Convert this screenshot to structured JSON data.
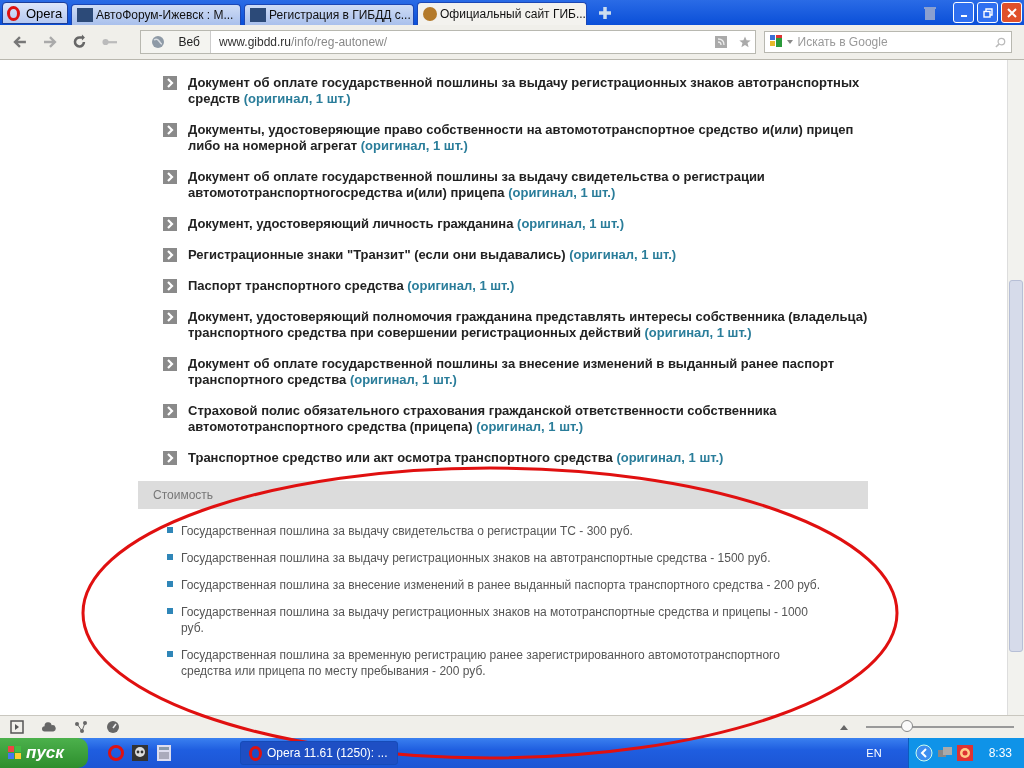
{
  "taskbar_top": {
    "menu_button": "Opera",
    "tabs": [
      {
        "title": "АвтоФорум-Ижевск : М...",
        "selected": false
      },
      {
        "title": "Регистрация в ГИБДД с...",
        "selected": false
      },
      {
        "title": "Официальный сайт ГИБ...",
        "selected": true
      }
    ]
  },
  "address_bar": {
    "label": "Веб",
    "url_host": "www.gibdd.ru",
    "url_path": "/info/reg-autonew/"
  },
  "search": {
    "placeholder": "Искать в Google"
  },
  "documents": [
    {
      "text": "Документ об оплате государственной пошлины за выдачу регистрационных знаков автотранспортных средств",
      "note": "(оригинал, 1 шт.)"
    },
    {
      "text": "Документы, удостоверяющие право собственности на автомототранспортное средство и(или) прицеп либо на номерной агрегат",
      "note": "(оригинал, 1 шт.)"
    },
    {
      "text": "Документ об оплате государственной пошлины за выдачу свидетельства о регистрации автомототранспортногосредства и(или) прицепа",
      "note": "(оригинал, 1 шт.)"
    },
    {
      "text": "Документ, удостоверяющий личность гражданина",
      "note": "(оригинал, 1 шт.)"
    },
    {
      "text": "Регистрационные знаки \"Транзит\" (если они выдавались)",
      "note": "(оригинал, 1 шт.)"
    },
    {
      "text": "Паспорт транспортного средства",
      "note": "(оригинал, 1 шт.)"
    },
    {
      "text": "Документ, удостоверяющий полномочия гражданина представлять интересы собственника (владельца) транспортного средства при совершении регистрационных действий",
      "note": "(оригинал, 1 шт.)"
    },
    {
      "text": "Документ об оплате государственной пошлины за внесение изменений в выданный ранее паспорт транспортного средства",
      "note": "(оригинал, 1 шт.)"
    },
    {
      "text": "Страховой полис обязательного страхования гражданской ответственности собственника автомототранспортного средства (прицепа)",
      "note": "(оригинал, 1 шт.)"
    },
    {
      "text": "Транспортное средство или акт осмотра транспортного средства",
      "note": "(оригинал, 1 шт.)"
    }
  ],
  "cost": {
    "title": "Стоимость",
    "items": [
      "Государственная пошлина за выдачу свидетельства о регистрации ТС - 300 руб.",
      "Государственная пошлина за выдачу регистрационных знаков на автотранспортные средства - 1500 руб.",
      "Государственная пошлина за внесение изменений в ранее выданный паспорта транспортного средства - 200 руб.",
      "Государственная пошлина за выдачу регистрационных знаков на мототранспортные средства и прицепы - 1000 руб.",
      "Государственная пошлина за временную регистрацию ранее зарегистрированного автомототранспортного средства или прицепа по месту пребывания - 200 руб."
    ]
  },
  "zoom_slider": {
    "level": 0.28
  },
  "windows_taskbar": {
    "start": "пуск",
    "task": "Opera 11.61 (1250): ...",
    "language": "EN",
    "clock": "8:33"
  }
}
